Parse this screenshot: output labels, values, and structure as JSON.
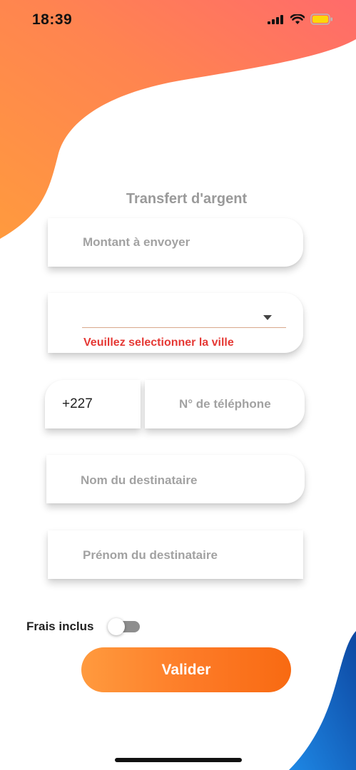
{
  "status_bar": {
    "time": "18:39",
    "icons": [
      "cellular-signal-icon",
      "wifi-icon",
      "battery-icon"
    ]
  },
  "form": {
    "title": "Transfert d'argent",
    "amount_placeholder": "Montant à envoyer",
    "city_select": {
      "value": "",
      "error": "Veuillez selectionner la ville"
    },
    "phone": {
      "country_code": "+227",
      "placeholder": "N° de téléphone"
    },
    "recipient_last_name_placeholder": "Nom du destinataire",
    "recipient_first_name_placeholder": "Prénom du destinataire",
    "fees_included": {
      "label": "Frais inclus",
      "checked": false
    },
    "submit_label": "Valider"
  },
  "colors": {
    "orange_start": "#ff9a3e",
    "orange_end": "#f86a12",
    "coral_top": "#ff6b6b",
    "blue_corner": "#1565c0",
    "error_red": "#e53935"
  }
}
